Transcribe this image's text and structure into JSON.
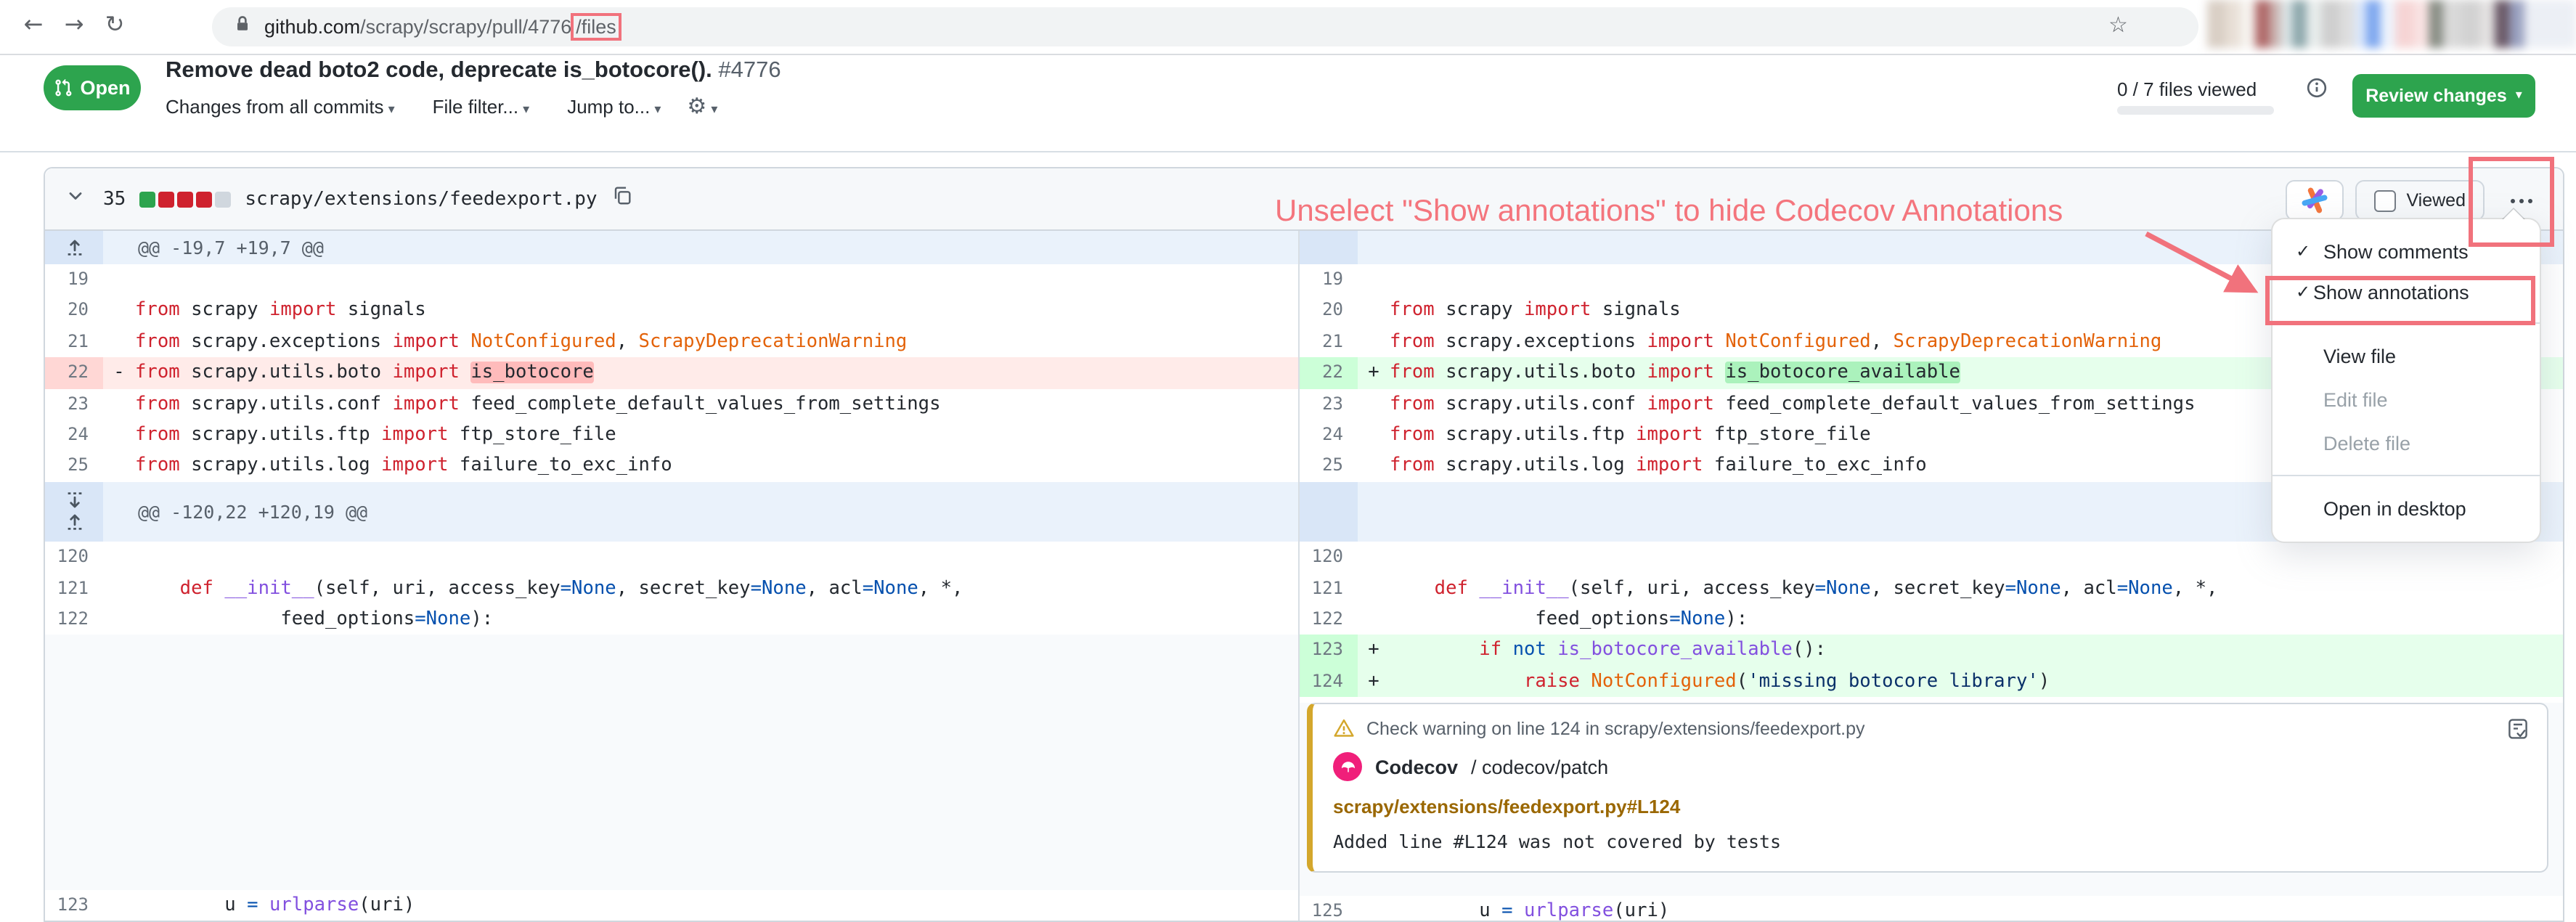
{
  "browser": {
    "url_host": "github.com",
    "url_path": "/scrapy/scrapy/pull/4776",
    "url_highlighted": "/files"
  },
  "pr": {
    "state": "Open",
    "title": "Remove dead boto2 code, deprecate is_botocore().",
    "number": "#4776",
    "commits_filter": "Changes from all commits",
    "file_filter": "File filter...",
    "jump_to": "Jump to...",
    "files_viewed": "0 / 7 files viewed",
    "review_button": "Review changes"
  },
  "file": {
    "changes": "35",
    "path": "scrapy/extensions/feedexport.py",
    "viewed": "Viewed",
    "diffstat_colors": [
      "#2da44e",
      "#cf222e",
      "#cf222e",
      "#cf222e",
      "#d0d7de"
    ]
  },
  "note": {
    "text": "Unselect \"Show annotations\" to hide Codecov Annotations",
    "color": "#f4757d"
  },
  "menu": {
    "items": [
      {
        "label": "Show comments",
        "checked": true
      },
      {
        "label": "Show annotations",
        "checked": true,
        "boxed": true,
        "tight": true
      },
      {
        "divider": true
      },
      {
        "label": "View file"
      },
      {
        "label": "Edit file",
        "disabled": true
      },
      {
        "label": "Delete file",
        "disabled": true
      },
      {
        "divider": true
      },
      {
        "label": "Open in desktop"
      }
    ]
  },
  "codecov": {
    "header": "Check warning on line 124 in scrapy/extensions/feedexport.py",
    "name": "Codecov",
    "context": "/ codecov/patch",
    "link": "scrapy/extensions/feedexport.py#L124",
    "message": "Added line #L124 was not covered by tests",
    "accent": "#d4a72c",
    "logo_color": "#f01f7a"
  },
  "diff": {
    "hunk1": "@@ -19,7 +19,7 @@",
    "hunk2": "@@ -120,22 +120,19 @@",
    "left": [
      {
        "t": "hunk",
        "x": "@@ -19,7 +19,7 @@",
        "ex": "up",
        "h": 23
      },
      {
        "n": "19",
        "s": []
      },
      {
        "n": "20",
        "s": [
          [
            "k",
            "from"
          ],
          [
            "t",
            " scrapy "
          ],
          [
            "k",
            "import"
          ],
          [
            "t",
            " signals"
          ]
        ]
      },
      {
        "n": "21",
        "s": [
          [
            "k",
            "from"
          ],
          [
            "t",
            " scrapy.exceptions "
          ],
          [
            "k",
            "import"
          ],
          [
            "t",
            " "
          ],
          [
            "e",
            "NotConfigured"
          ],
          [
            "t",
            ", "
          ],
          [
            "e",
            "ScrapyDeprecationWarning"
          ]
        ]
      },
      {
        "n": "22",
        "b": "del",
        "m": "-",
        "s": [
          [
            "k",
            "from"
          ],
          [
            "t",
            " scrapy.utils.boto "
          ],
          [
            "k",
            "import"
          ],
          [
            "t",
            " "
          ],
          [
            "dw",
            "is_botocore"
          ]
        ]
      },
      {
        "n": "23",
        "s": [
          [
            "k",
            "from"
          ],
          [
            "t",
            " scrapy.utils.conf "
          ],
          [
            "k",
            "import"
          ],
          [
            "t",
            " feed_complete_default_values_from_settings"
          ]
        ]
      },
      {
        "n": "24",
        "s": [
          [
            "k",
            "from"
          ],
          [
            "t",
            " scrapy.utils.ftp "
          ],
          [
            "k",
            "import"
          ],
          [
            "t",
            " ftp_store_file"
          ]
        ]
      },
      {
        "n": "25",
        "s": [
          [
            "k",
            "from"
          ],
          [
            "t",
            " scrapy.utils.log "
          ],
          [
            "k",
            "import"
          ],
          [
            "t",
            " failure_to_exc_info"
          ]
        ]
      },
      {
        "t": "hunk",
        "x": "@@ -120,22 +120,19 @@",
        "ex": "both",
        "h": 41.5
      },
      {
        "n": "120",
        "s": []
      },
      {
        "n": "121",
        "s": [
          [
            "t",
            "    "
          ],
          [
            "k",
            "def"
          ],
          [
            "t",
            " "
          ],
          [
            "f",
            "__init__"
          ],
          [
            "t",
            "(self, uri, access_key"
          ],
          [
            "c",
            "=None"
          ],
          [
            "t",
            ", secret_key"
          ],
          [
            "c",
            "=None"
          ],
          [
            "t",
            ", acl"
          ],
          [
            "c",
            "=None"
          ],
          [
            "t",
            ", *,"
          ]
        ]
      },
      {
        "n": "122",
        "s": [
          [
            "t",
            "             feed_options"
          ],
          [
            "c",
            "=None"
          ],
          [
            "t",
            "):"
          ]
        ]
      },
      {
        "t": "fill",
        "h": 175.3
      },
      {
        "n": "123",
        "s": [
          [
            "t",
            "        u "
          ],
          [
            "c",
            "="
          ],
          [
            "t",
            " "
          ],
          [
            "f",
            "urlparse"
          ],
          [
            "t",
            "(uri)"
          ]
        ]
      }
    ],
    "right": [
      {
        "t": "hunk",
        "x": "",
        "ex": "",
        "h": 23
      },
      {
        "n": "19",
        "s": []
      },
      {
        "n": "20",
        "s": [
          [
            "k",
            "from"
          ],
          [
            "t",
            " scrapy "
          ],
          [
            "k",
            "import"
          ],
          [
            "t",
            " signals"
          ]
        ]
      },
      {
        "n": "21",
        "s": [
          [
            "k",
            "from"
          ],
          [
            "t",
            " scrapy.exceptions "
          ],
          [
            "k",
            "import"
          ],
          [
            "t",
            " "
          ],
          [
            "e",
            "NotConfigured"
          ],
          [
            "t",
            ", "
          ],
          [
            "e",
            "ScrapyDeprecationWarning"
          ]
        ]
      },
      {
        "n": "22",
        "b": "add",
        "m": "+",
        "s": [
          [
            "k",
            "from"
          ],
          [
            "t",
            " scrapy.utils.boto "
          ],
          [
            "k",
            "import"
          ],
          [
            "t",
            " "
          ],
          [
            "aw",
            "is_botocore_available"
          ]
        ]
      },
      {
        "n": "23",
        "s": [
          [
            "k",
            "from"
          ],
          [
            "t",
            " scrapy.utils.conf "
          ],
          [
            "k",
            "import"
          ],
          [
            "t",
            " feed_complete_default_values_from_settings"
          ]
        ]
      },
      {
        "n": "24",
        "s": [
          [
            "k",
            "from"
          ],
          [
            "t",
            " scrapy.utils.ftp "
          ],
          [
            "k",
            "import"
          ],
          [
            "t",
            " ftp_store_file"
          ]
        ]
      },
      {
        "n": "25",
        "s": [
          [
            "k",
            "from"
          ],
          [
            "t",
            " scrapy.utils.log "
          ],
          [
            "k",
            "import"
          ],
          [
            "t",
            " failure_to_exc_info"
          ]
        ]
      },
      {
        "t": "hunk",
        "x": "",
        "ex": "",
        "h": 41.5
      },
      {
        "n": "120",
        "s": []
      },
      {
        "n": "121",
        "s": [
          [
            "t",
            "    "
          ],
          [
            "k",
            "def"
          ],
          [
            "t",
            " "
          ],
          [
            "f",
            "__init__"
          ],
          [
            "t",
            "(self, uri, access_key"
          ],
          [
            "c",
            "=None"
          ],
          [
            "t",
            ", secret_key"
          ],
          [
            "c",
            "=None"
          ],
          [
            "t",
            ", acl"
          ],
          [
            "c",
            "=None"
          ],
          [
            "t",
            ", *,"
          ]
        ]
      },
      {
        "n": "122",
        "s": [
          [
            "t",
            "             feed_options"
          ],
          [
            "c",
            "=None"
          ],
          [
            "t",
            "):"
          ]
        ]
      },
      {
        "n": "123",
        "b": "add",
        "m": "+",
        "s": [
          [
            "t",
            "        "
          ],
          [
            "k",
            "if"
          ],
          [
            "t",
            " "
          ],
          [
            "c",
            "not"
          ],
          [
            "t",
            " "
          ],
          [
            "f",
            "is_botocore_available"
          ],
          [
            "t",
            "():"
          ]
        ]
      },
      {
        "n": "124",
        "b": "add",
        "m": "+",
        "s": [
          [
            "t",
            "            "
          ],
          [
            "k",
            "raise"
          ],
          [
            "t",
            " "
          ],
          [
            "e",
            "NotConfigured"
          ],
          [
            "t",
            "("
          ],
          [
            "s",
            "'missing botocore library'"
          ],
          [
            "t",
            ")"
          ]
        ]
      },
      {
        "t": "note",
        "h": 132.5
      },
      {
        "n": "125",
        "s": [
          [
            "t",
            "        u "
          ],
          [
            "c",
            "="
          ],
          [
            "t",
            " "
          ],
          [
            "f",
            "urlparse"
          ],
          [
            "t",
            "(uri)"
          ]
        ]
      }
    ]
  }
}
